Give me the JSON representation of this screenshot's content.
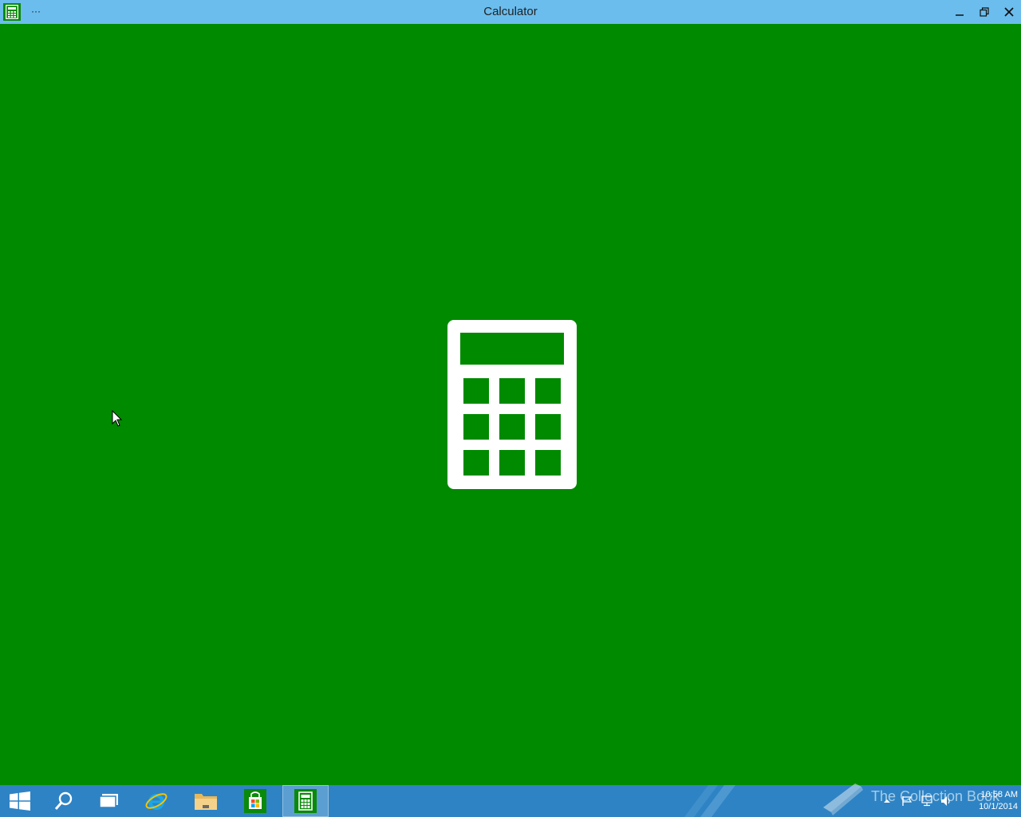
{
  "window": {
    "title": "Calculator",
    "menu_label": "···",
    "controls": [
      "minimize",
      "restore",
      "close"
    ],
    "background_color": "#008a00",
    "titlebar_color": "#6bbdee"
  },
  "splash": {
    "icon": "calculator-icon",
    "icon_color": "#ffffff"
  },
  "taskbar": {
    "color": "#2e83c4",
    "items": [
      {
        "name": "start-button",
        "icon": "windows-logo-icon"
      },
      {
        "name": "search-button",
        "icon": "search-icon"
      },
      {
        "name": "task-view-button",
        "icon": "task-view-icon"
      },
      {
        "name": "internet-explorer-button",
        "icon": "internet-explorer-icon"
      },
      {
        "name": "file-explorer-button",
        "icon": "folder-icon"
      },
      {
        "name": "store-button",
        "icon": "store-icon"
      },
      {
        "name": "calculator-button",
        "icon": "calculator-icon",
        "active": true
      }
    ],
    "watermark_text": "The Collection Book",
    "tray_icons": [
      "show-hidden-icons-icon",
      "action-center-flag-icon",
      "network-icon",
      "volume-icon"
    ],
    "clock": {
      "time": "10:58 AM",
      "date": "10/1/2014"
    }
  }
}
